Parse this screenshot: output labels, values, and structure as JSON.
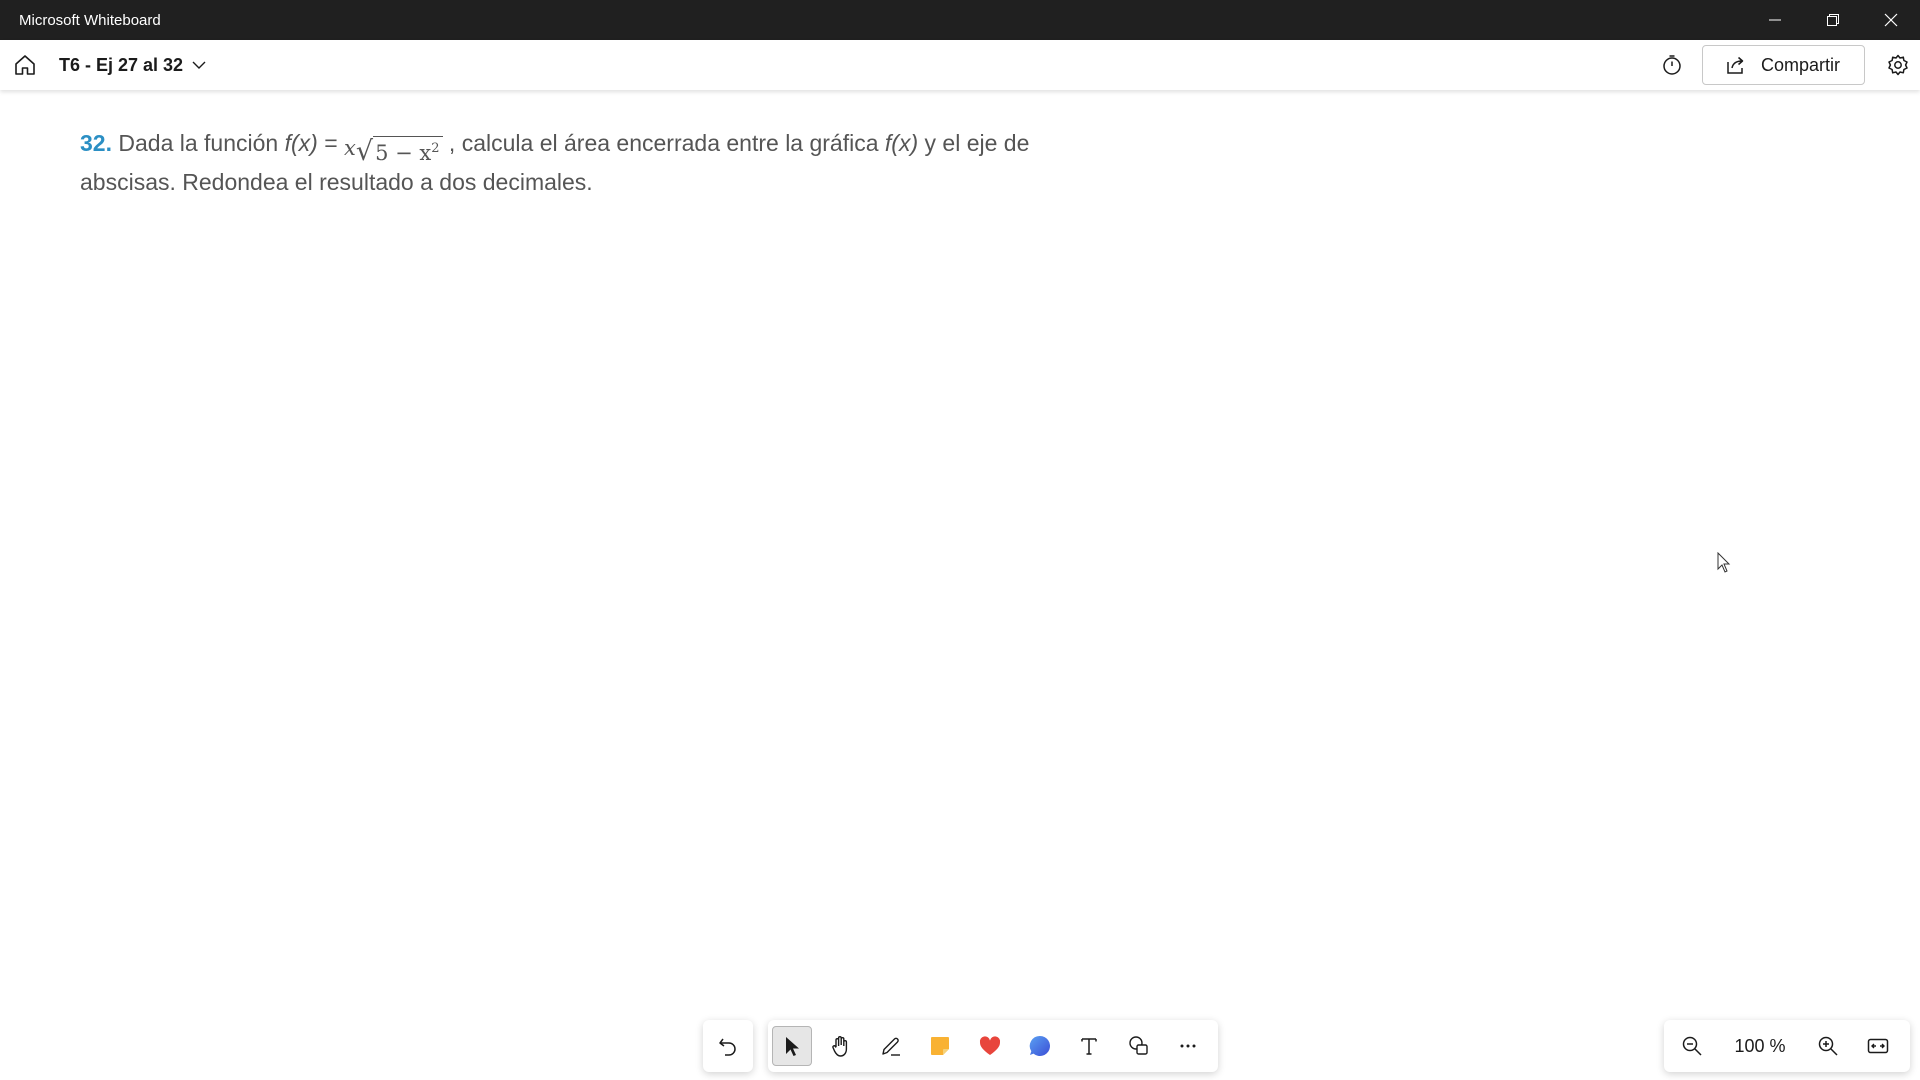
{
  "window": {
    "title": "Microsoft Whiteboard",
    "controls": [
      "minimize-icon",
      "restore-icon",
      "close-icon"
    ]
  },
  "toolbar": {
    "board_title": "T6 - Ej 27 al 32",
    "share_label": "Compartir",
    "icons": [
      "home-icon",
      "chevron-down-icon",
      "timer-icon",
      "share-icon",
      "gear-icon"
    ]
  },
  "problem": {
    "number": "32.",
    "text_before": " Dada la función ",
    "fx": "f(x)",
    "equals": " = ",
    "x": "x",
    "radicand": "5 − x",
    "exponent": "2",
    "text_middle": " , calcula el área encerrada entre la gráfica ",
    "fx2": "f(x)",
    "text_after": " y el eje de abscisas. Redondea el resultado a dos decimales."
  },
  "tools": {
    "undo": "undo-icon",
    "items": [
      {
        "name": "select-tool",
        "icon": "pointer-icon",
        "active": true
      },
      {
        "name": "pan-tool",
        "icon": "hand-icon",
        "active": false
      },
      {
        "name": "pen-tool",
        "icon": "pen-icon",
        "active": false
      },
      {
        "name": "sticky-note-tool",
        "icon": "sticky-note-icon",
        "active": false
      },
      {
        "name": "reactions-tool",
        "icon": "heart-icon",
        "active": false
      },
      {
        "name": "comment-tool",
        "icon": "comment-icon",
        "active": false
      },
      {
        "name": "text-tool",
        "icon": "text-icon",
        "active": false
      },
      {
        "name": "shapes-tool",
        "icon": "shapes-icon",
        "active": false
      },
      {
        "name": "more-tool",
        "icon": "more-icon",
        "active": false
      }
    ]
  },
  "zoom": {
    "level": "100 %",
    "icons": [
      "zoom-out-icon",
      "zoom-in-icon",
      "fit-to-screen-icon"
    ]
  },
  "colors": {
    "titlebar": "#202020",
    "accent_number": "#2b8fc4",
    "sticky_note": "#f9b233",
    "heart": "#e8453c",
    "comment": "#3b6fe0"
  }
}
